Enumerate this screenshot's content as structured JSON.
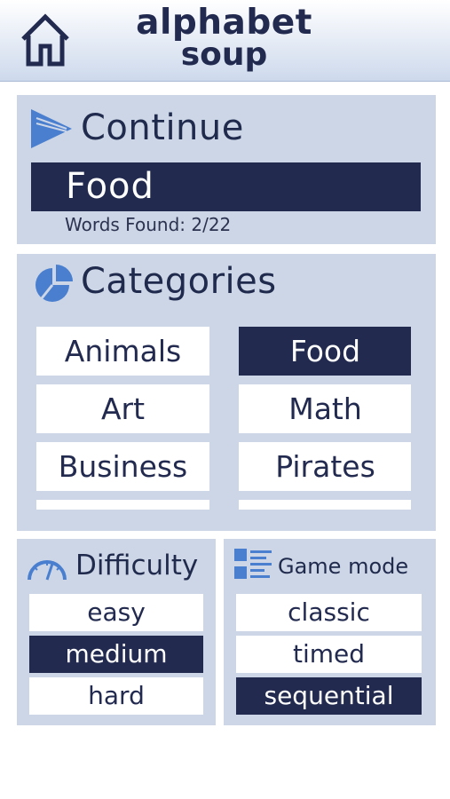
{
  "header": {
    "brand_line1": "alphabet",
    "brand_line2": "soup",
    "home_icon": "home-icon"
  },
  "continue": {
    "title": "Continue",
    "icon": "play-icon",
    "current_category": "Food",
    "words_found_text": "Words Found: 2/22"
  },
  "categories": {
    "title": "Categories",
    "icon": "pie-chart-icon",
    "items": [
      {
        "label": "Animals",
        "selected": false
      },
      {
        "label": "Food",
        "selected": true
      },
      {
        "label": "Art",
        "selected": false
      },
      {
        "label": "Math",
        "selected": false
      },
      {
        "label": "Business",
        "selected": false
      },
      {
        "label": "Pirates",
        "selected": false
      },
      {
        "label": "",
        "selected": false
      },
      {
        "label": "",
        "selected": false
      }
    ]
  },
  "difficulty": {
    "title": "Difficulty",
    "icon": "gauge-icon",
    "options": [
      {
        "label": "easy",
        "selected": false
      },
      {
        "label": "medium",
        "selected": true
      },
      {
        "label": "hard",
        "selected": false
      }
    ]
  },
  "game_mode": {
    "title": "Game mode",
    "icon": "list-icon",
    "options": [
      {
        "label": "classic",
        "selected": false
      },
      {
        "label": "timed",
        "selected": false
      },
      {
        "label": "sequential",
        "selected": true
      }
    ]
  },
  "colors": {
    "navy": "#222a4f",
    "panel": "#cdd6e6",
    "accent_blue": "#4a7fd0"
  }
}
